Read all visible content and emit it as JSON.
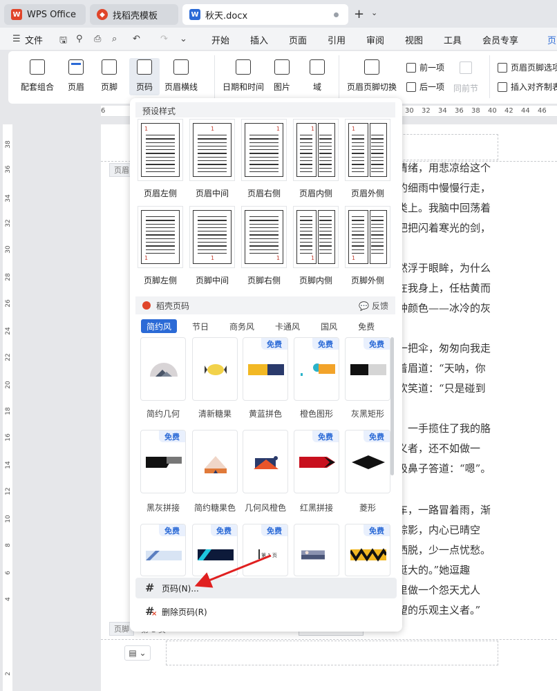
{
  "tabs": [
    {
      "label": "WPS Office",
      "icon": "wps-logo-icon"
    },
    {
      "label": "找稻壳模板",
      "icon": "docer-logo-icon"
    },
    {
      "label": "秋天.docx",
      "icon": "word-doc-icon"
    }
  ],
  "menu": [
    "文件",
    "开始",
    "插入",
    "页面",
    "引用",
    "审阅",
    "视图",
    "工具",
    "会员专享",
    "页"
  ],
  "ribbon": {
    "combo": "配套组合",
    "header": "页眉",
    "footer": "页脚",
    "pagenum": "页码",
    "header_line": "页眉横线",
    "datetime": "日期和时间",
    "picture": "图片",
    "field": "域",
    "switch": "页眉页脚切换",
    "prev": "前一项",
    "next": "后一项",
    "same_prev": "同前节",
    "hf_options": "页眉页脚选项",
    "insert_align": "插入对齐制表"
  },
  "hruler_ticks": [
    "6",
    "30",
    "32",
    "34",
    "36",
    "38",
    "40",
    "42",
    "44",
    "46"
  ],
  "vruler_ticks": [
    "38",
    "36",
    "34",
    "32",
    "30",
    "28",
    "26",
    "24",
    "22",
    "20",
    "18",
    "16",
    "14",
    "12",
    "10",
    "8",
    "6",
    "4",
    "2"
  ],
  "doc": {
    "header_tag": "页眉",
    "footer_tag": "页脚",
    "footer_text": "第 1 页",
    "lines": [
      "的情绪，用悲凉给这个",
      "瑟的细雨中慢慢行走，",
      "悲类上。我脑中回荡着",
      "一把把闪着寒光的剑，",
      "蓦然浮于眼眸，为什么",
      "落在我身上，任枯黄而",
      "一种颜色——冰冷的灰",
      "了一把伞，匆匆向我走",
      "皱着眉道：“天呐，你",
      "喜欢笑道：“只是碰到",
      "笑，一手揽住了我的胳",
      "主义者，还不如做一",
      "了吸鼻子答道：“嗯”。",
      "。",
      "下车，一路冒着雨，渐",
      "无踪影，内心已晴空",
      "点洒脱，少一点忧愁。",
      "还挺大的。”她逗趣",
      "这里做一个怨天尤人",
      "希望的乐观主义者。”"
    ]
  },
  "panel": {
    "preset_title": "预设样式",
    "presets": [
      "页眉左侧",
      "页眉中间",
      "页眉右侧",
      "页眉内侧",
      "页眉外侧",
      "页脚左侧",
      "页脚中间",
      "页脚右侧",
      "页脚内侧",
      "页脚外侧"
    ],
    "preset_num": "1",
    "docer_title": "稻壳页码",
    "feedback": "反馈",
    "filter_tabs": [
      "简约风",
      "节日",
      "商务风",
      "卡通风",
      "国风",
      "免费"
    ],
    "free_badge": "免费",
    "cards_row1": [
      "简约几何",
      "清新糖果",
      "黄蓝拼色",
      "橙色图形",
      "灰黑矩形"
    ],
    "cards_row2": [
      "黑灰拼接",
      "简约糖果色",
      "几何风橙色",
      "红黑拼接",
      "菱形"
    ],
    "card_page_text": "第 1 页",
    "menu_pagenum": "页码(N)...",
    "menu_delete": "删除页码(R)"
  },
  "colors": {
    "accent": "#2b6ad6",
    "arrow": "#e02020",
    "wps_red": "#e0452a"
  }
}
